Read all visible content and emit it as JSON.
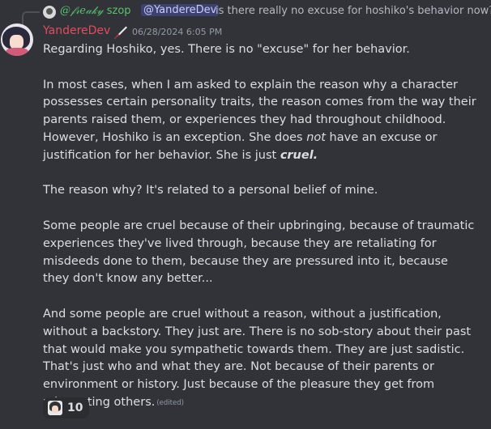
{
  "reply": {
    "author_fancy": "@𝒻𝓇𝑒𝒶𝓀𝓎",
    "author_suffix": "szop",
    "mention": "@YandereDev",
    "text": "is there really no excuse for hoshiko's behavior now?"
  },
  "message": {
    "author": "YandereDev",
    "author_color": "#e04d5e",
    "badge_icon": "knife-icon",
    "timestamp": "06/28/2024 6:05 PM",
    "paragraph_1": "Regarding Hoshiko, yes. There is no \"excuse\" for her behavior.",
    "paragraph_2_a": "In most cases, when I am asked to explain the reason why a character possesses certain personality traits, the reason comes from the way their parents raised them, or experiences they had throughout childhood. However, Hoshiko is an exception. She does ",
    "paragraph_2_not": "not",
    "paragraph_2_b": " have an excuse or justification for her behavior. She is just ",
    "paragraph_2_cruel": "cruel.",
    "paragraph_3": "The reason why? It's related to a personal belief of mine.",
    "paragraph_4": "Some people are cruel because of their upbringing, because of traumatic experiences they've lived through, because they are retaliating for misdeeds done to them, because they are pressured into it, because they don't know any better...",
    "paragraph_5": "And some people are cruel without a reason, without a justification, without a backstory. They just are. There is no sob-story about their past that would make you sympathetic towards them. They are just sadistic. That's just who and what they are. Not because of their parents or environment or history. Just because of the pleasure they get from mistreating others.",
    "edited_label": "(edited)"
  },
  "reaction": {
    "emoji": "anime-girl-emoji",
    "count": "10"
  },
  "colors": {
    "background": "#313338",
    "text": "#dbdee1",
    "muted": "#949ba4",
    "mention_bg": "#3c4270",
    "reply_author": "#57c36c"
  }
}
